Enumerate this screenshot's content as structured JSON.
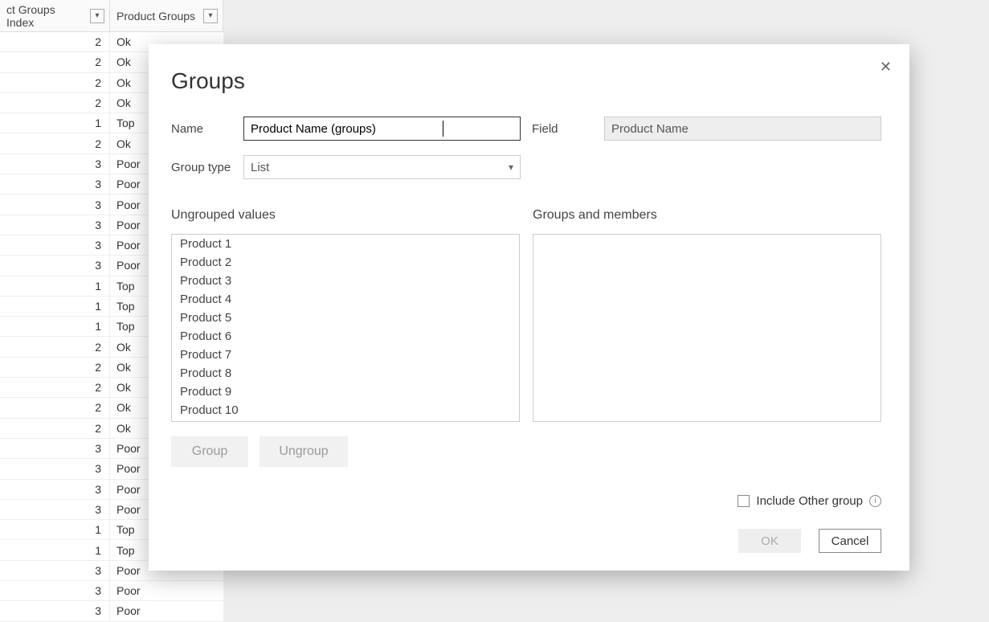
{
  "table": {
    "headers": {
      "index": "ct Groups Index",
      "pg": "Product Groups"
    },
    "rows": [
      {
        "idx": "2",
        "pg": "Ok"
      },
      {
        "idx": "2",
        "pg": "Ok"
      },
      {
        "idx": "2",
        "pg": "Ok"
      },
      {
        "idx": "2",
        "pg": "Ok"
      },
      {
        "idx": "1",
        "pg": "Top"
      },
      {
        "idx": "2",
        "pg": "Ok"
      },
      {
        "idx": "3",
        "pg": "Poor"
      },
      {
        "idx": "3",
        "pg": "Poor"
      },
      {
        "idx": "3",
        "pg": "Poor"
      },
      {
        "idx": "3",
        "pg": "Poor"
      },
      {
        "idx": "3",
        "pg": "Poor"
      },
      {
        "idx": "3",
        "pg": "Poor"
      },
      {
        "idx": "1",
        "pg": "Top"
      },
      {
        "idx": "1",
        "pg": "Top"
      },
      {
        "idx": "1",
        "pg": "Top"
      },
      {
        "idx": "2",
        "pg": "Ok"
      },
      {
        "idx": "2",
        "pg": "Ok"
      },
      {
        "idx": "2",
        "pg": "Ok"
      },
      {
        "idx": "2",
        "pg": "Ok"
      },
      {
        "idx": "2",
        "pg": "Ok"
      },
      {
        "idx": "3",
        "pg": "Poor"
      },
      {
        "idx": "3",
        "pg": "Poor"
      },
      {
        "idx": "3",
        "pg": "Poor"
      },
      {
        "idx": "3",
        "pg": "Poor"
      },
      {
        "idx": "1",
        "pg": "Top"
      },
      {
        "idx": "1",
        "pg": "Top"
      },
      {
        "idx": "3",
        "pg": "Poor"
      },
      {
        "idx": "3",
        "pg": "Poor"
      },
      {
        "idx": "3",
        "pg": "Poor"
      }
    ]
  },
  "dialog": {
    "title": "Groups",
    "labels": {
      "name": "Name",
      "field": "Field",
      "group_type": "Group type",
      "ungrouped": "Ungrouped values",
      "groups_members": "Groups and members",
      "include_other": "Include Other group"
    },
    "name_value": "Product Name (groups)",
    "field_value": "Product Name",
    "group_type_value": "List",
    "ungrouped_items": [
      "Product 1",
      "Product 2",
      "Product 3",
      "Product 4",
      "Product 5",
      "Product 6",
      "Product 7",
      "Product 8",
      "Product 9",
      "Product 10"
    ],
    "buttons": {
      "group": "Group",
      "ungroup": "Ungroup",
      "ok": "OK",
      "cancel": "Cancel"
    }
  }
}
